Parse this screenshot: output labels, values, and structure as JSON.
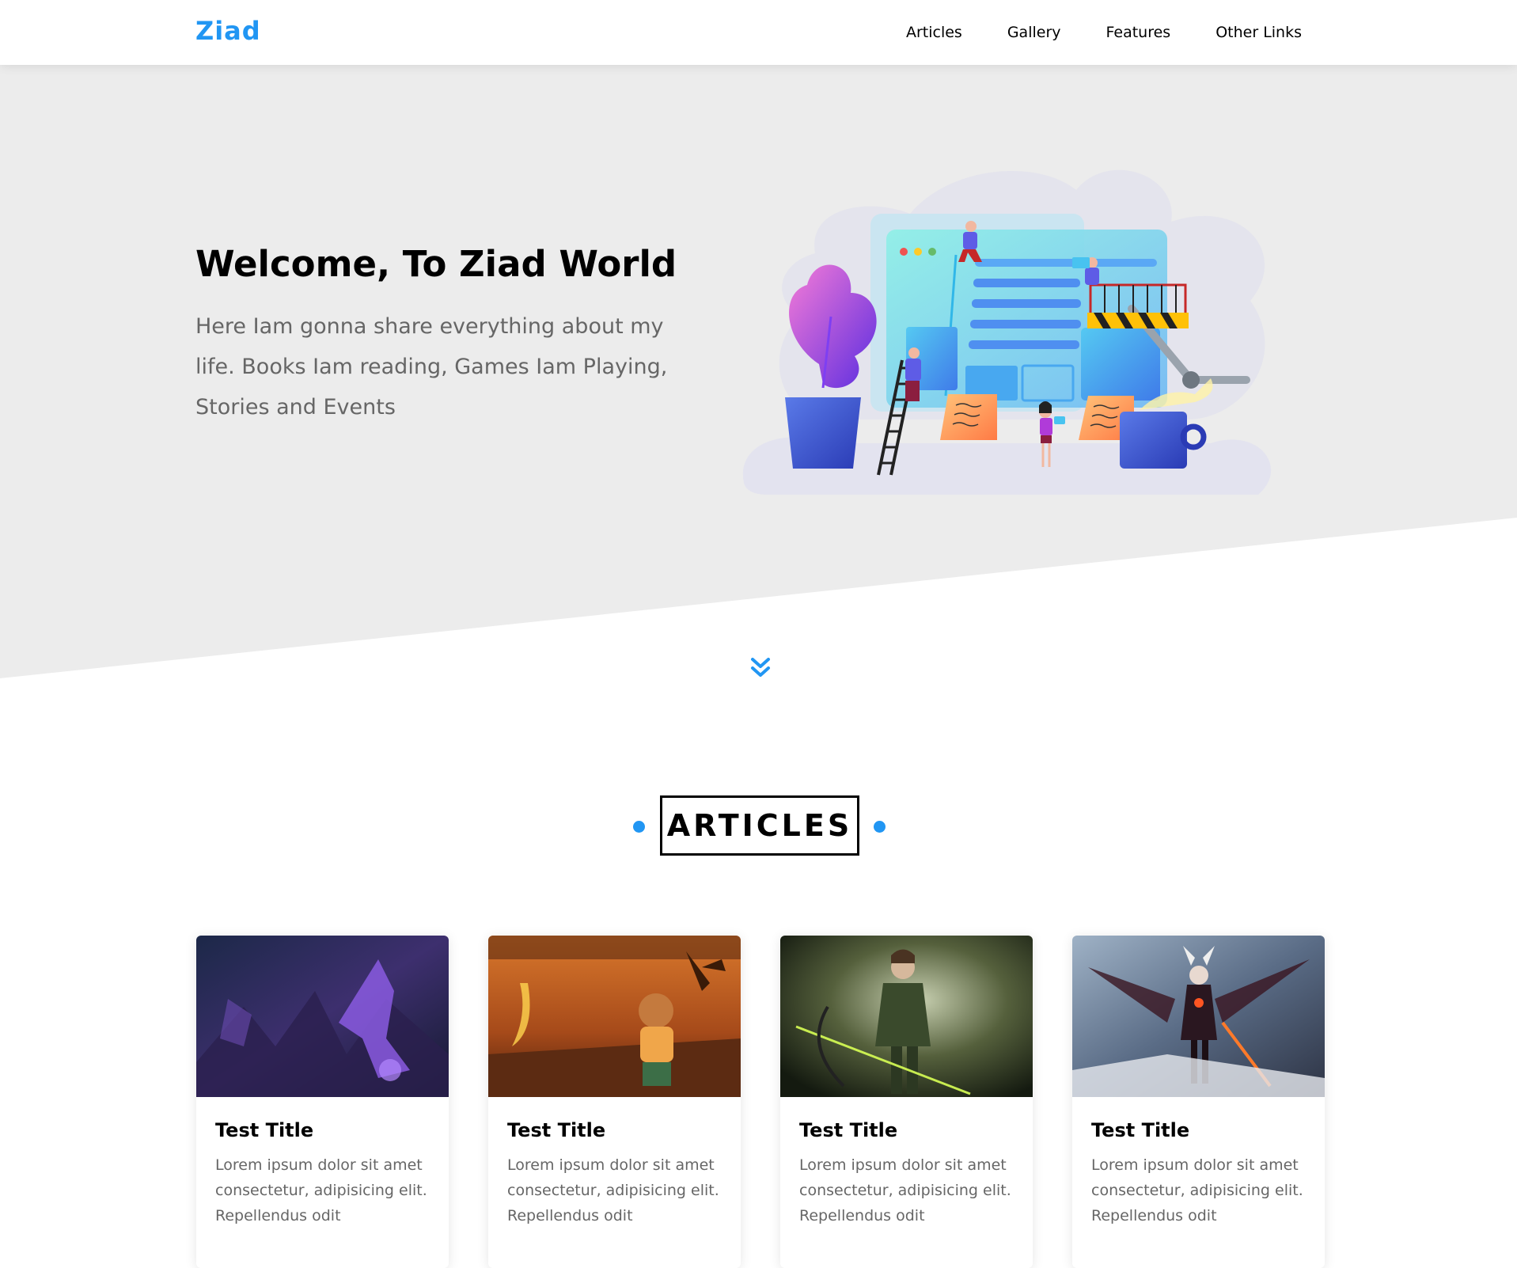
{
  "header": {
    "logo": "Ziad",
    "nav": [
      {
        "label": "Articles"
      },
      {
        "label": "Gallery"
      },
      {
        "label": "Features"
      },
      {
        "label": "Other Links"
      }
    ]
  },
  "landing": {
    "title": "Welcome, To Ziad World",
    "text": "Here Iam gonna share everything about my life. Books Iam reading, Games Iam Playing, Stories and Events",
    "illustration_icon": "web-design-illustration",
    "scroll_icon": "angles-down-icon"
  },
  "articles": {
    "title": "ARTICLES",
    "cards": [
      {
        "title": "Test Title",
        "text": "Lorem ipsum dolor sit amet consectetur, adipisicing elit. Repellendus odit"
      },
      {
        "title": "Test Title",
        "text": "Lorem ipsum dolor sit amet consectetur, adipisicing elit. Repellendus odit"
      },
      {
        "title": "Test Title",
        "text": "Lorem ipsum dolor sit amet consectetur, adipisicing elit. Repellendus odit"
      },
      {
        "title": "Test Title",
        "text": "Lorem ipsum dolor sit amet consectetur, adipisicing elit. Repellendus odit"
      }
    ]
  },
  "colors": {
    "accent": "#2196f3",
    "landing_bg": "#ececec",
    "text_muted": "#666666"
  }
}
